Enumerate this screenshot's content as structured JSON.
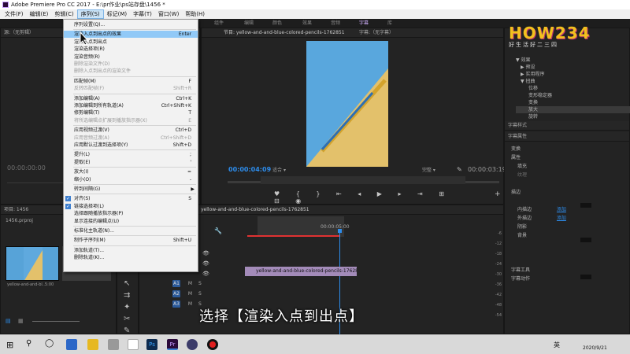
{
  "window": {
    "title": "Adobe Premiere Pro CC 2017 - E:\\pr作业\\ps站存盘\\1456 *"
  },
  "menubar": {
    "items": [
      "文件(F)",
      "编辑(E)",
      "剪辑(C)",
      "序列(S)",
      "标记(M)",
      "字幕(T)",
      "窗口(W)",
      "帮助(H)"
    ],
    "active": "序列(S)"
  },
  "workspace_tabs": [
    "组件",
    "编辑",
    "颜色",
    "效果",
    "音频",
    "字幕",
    "库"
  ],
  "workspace_active": "字幕",
  "source_panel": {
    "title": "源:（无剪辑）",
    "timecode_left": "00:00:00:00"
  },
  "program_panel": {
    "title": "节目: yellow-and-and-blue-colored-pencils-1762851",
    "title2": "字幕:（无字幕）",
    "timecode": "00:00:04:09",
    "fit": "适合",
    "quality": "完整",
    "duration": "00:00:03:19"
  },
  "project_panel": {
    "title": "项目: 1456",
    "file": "1456.prproj",
    "clip_name": "yellow-and-and-bl...",
    "clip_duration": "5:00"
  },
  "timeline": {
    "tab": "yellow-and-and-blue-colored-pencils-1762851",
    "ruler_label": "00:00:05:00",
    "clip_label": "yellow-and-and-blue-colored-pencils-1762851.mp4",
    "audio_tracks": [
      "A1",
      "A2",
      "A3"
    ],
    "track_buttons": [
      "M",
      "S"
    ]
  },
  "effects_panel": {
    "tree": [
      "▼ 效果",
      "▶ 预设",
      "▶ 实用程序",
      "▼ 扭曲",
      "位移",
      "变形稳定器",
      "变换",
      "放大",
      "旋转"
    ],
    "selected": "放大"
  },
  "essential_graphics": {
    "title": "字幕样式",
    "sub": "字幕属性",
    "rows": [
      "变换",
      "属性",
      "填充",
      "纹理",
      "描边",
      "内描边",
      "外描边",
      "阴影",
      "背景",
      "字幕工具",
      "字幕动作"
    ],
    "add_label": "添加"
  },
  "menu": {
    "items": [
      {
        "label": "序列设置(Q)...",
        "shortcut": "",
        "enabled": true
      },
      {
        "sep": true
      },
      {
        "label": "渲染入点到出点的效果",
        "shortcut": "Enter",
        "enabled": true,
        "highlighted": true
      },
      {
        "label": "渲染入点到出点",
        "shortcut": "",
        "enabled": true
      },
      {
        "label": "渲染选择项(R)",
        "shortcut": "",
        "enabled": true
      },
      {
        "label": "渲染音频(R)",
        "shortcut": "",
        "enabled": true
      },
      {
        "label": "删除渲染文件(D)",
        "shortcut": "",
        "enabled": false
      },
      {
        "label": "删除入点到出点的渲染文件",
        "shortcut": "",
        "enabled": false
      },
      {
        "sep": true
      },
      {
        "label": "匹配帧(M)",
        "shortcut": "F",
        "enabled": true
      },
      {
        "label": "反转匹配帧(F)",
        "shortcut": "Shift+R",
        "enabled": false
      },
      {
        "sep": true
      },
      {
        "label": "添加编辑(A)",
        "shortcut": "Ctrl+K",
        "enabled": true
      },
      {
        "label": "添加编辑到所有轨道(A)",
        "shortcut": "Ctrl+Shift+K",
        "enabled": true
      },
      {
        "label": "修剪编辑(T)",
        "shortcut": "T",
        "enabled": true
      },
      {
        "label": "将所选编辑点扩展到播放指示器(X)",
        "shortcut": "E",
        "enabled": false
      },
      {
        "sep": true
      },
      {
        "label": "应用视频过渡(V)",
        "shortcut": "Ctrl+D",
        "enabled": true
      },
      {
        "label": "应用音频过渡(A)",
        "shortcut": "Ctrl+Shift+D",
        "enabled": false
      },
      {
        "label": "应用默认过渡到选择项(Y)",
        "shortcut": "Shift+D",
        "enabled": true
      },
      {
        "sep": true
      },
      {
        "label": "提升(L)",
        "shortcut": ";",
        "enabled": true
      },
      {
        "label": "提取(E)",
        "shortcut": "'",
        "enabled": true
      },
      {
        "sep": true
      },
      {
        "label": "放大(I)",
        "shortcut": "=",
        "enabled": true
      },
      {
        "label": "缩小(O)",
        "shortcut": "-",
        "enabled": true
      },
      {
        "sep": true
      },
      {
        "label": "转到间隔(G)",
        "shortcut": "",
        "enabled": true,
        "submenu": true
      },
      {
        "sep": true
      },
      {
        "label": "对齐(S)",
        "shortcut": "S",
        "enabled": true,
        "checked": true
      },
      {
        "label": "链接选择项(L)",
        "shortcut": "",
        "enabled": true,
        "checked": true
      },
      {
        "label": "选择跟随播放指示器(P)",
        "shortcut": "",
        "enabled": true
      },
      {
        "label": "显示连接的编辑点(U)",
        "shortcut": "",
        "enabled": true
      },
      {
        "sep": true
      },
      {
        "label": "标准化主轨道(N)...",
        "shortcut": "",
        "enabled": true
      },
      {
        "sep": true
      },
      {
        "label": "制作子序列(M)",
        "shortcut": "Shift+U",
        "enabled": true
      },
      {
        "sep": true
      },
      {
        "label": "添加轨道(T)...",
        "shortcut": "",
        "enabled": true
      },
      {
        "label": "删除轨道(K)...",
        "shortcut": "",
        "enabled": true
      }
    ]
  },
  "subtitle": "选择【渲染入点到出点】",
  "brand": {
    "line1": "HOW234",
    "line2": "好生活好二三四"
  },
  "taskbar": {
    "ime": "英",
    "date": "2020/9/21",
    "app_name": "Pr"
  }
}
